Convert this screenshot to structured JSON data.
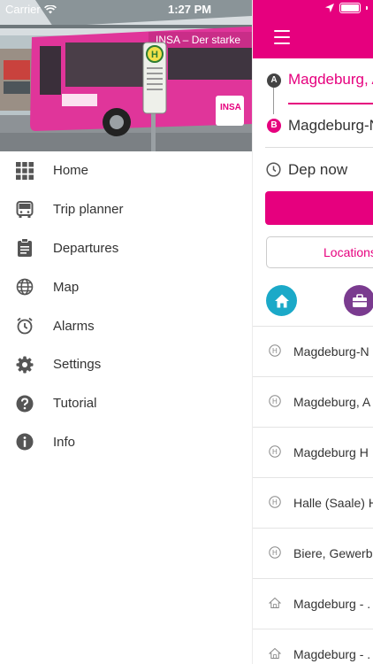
{
  "status_bar": {
    "carrier": "Carrier",
    "time": "1:27 PM"
  },
  "drawer": {
    "menu_items": [
      {
        "label": "Home",
        "icon": "grid-icon"
      },
      {
        "label": "Trip planner",
        "icon": "bus-icon"
      },
      {
        "label": "Departures",
        "icon": "clipboard-icon"
      },
      {
        "label": "Map",
        "icon": "globe-icon"
      },
      {
        "label": "Alarms",
        "icon": "alarm-clock-icon"
      },
      {
        "label": "Settings",
        "icon": "gear-icon"
      },
      {
        "label": "Tutorial",
        "icon": "help-icon"
      },
      {
        "label": "Info",
        "icon": "info-icon"
      }
    ],
    "photo": {
      "bus_banner_text": "INSA – Der starke",
      "stop_sign_letter": "H",
      "bus_logo": "INSA"
    }
  },
  "main": {
    "from_badge": "A",
    "to_badge": "B",
    "from_value": "Magdeburg, A",
    "to_value": "Magdeburg-N",
    "departure_label": "Dep now",
    "locations_button": "Locations",
    "location_list": [
      {
        "label": "Magdeburg-N",
        "type": "stop"
      },
      {
        "label": "Magdeburg, A",
        "type": "stop"
      },
      {
        "label": "Magdeburg H",
        "type": "stop"
      },
      {
        "label": "Halle (Saale) H",
        "type": "stop"
      },
      {
        "label": "Biere, Gewerb",
        "type": "stop"
      },
      {
        "label": "Magdeburg - .",
        "type": "address"
      },
      {
        "label": "Magdeburg - .",
        "type": "address"
      }
    ]
  },
  "colors": {
    "accent": "#e6007e",
    "home_favorite": "#1ba9c8",
    "work_favorite": "#7a3b8f"
  }
}
